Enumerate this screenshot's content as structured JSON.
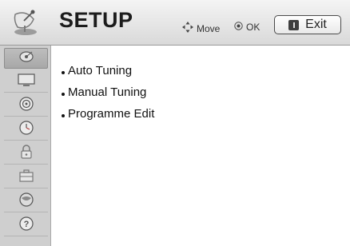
{
  "header": {
    "title": "SETUP",
    "hint_move": "Move",
    "hint_ok": "OK",
    "exit_label": "Exit"
  },
  "sidebar": {
    "items": [
      {
        "icon": "satellite-dish-icon",
        "active": true
      },
      {
        "icon": "display-icon",
        "active": false
      },
      {
        "icon": "audio-icon",
        "active": false
      },
      {
        "icon": "clock-icon",
        "active": false
      },
      {
        "icon": "lock-icon",
        "active": false
      },
      {
        "icon": "toolbox-icon",
        "active": false
      },
      {
        "icon": "network-icon",
        "active": false
      },
      {
        "icon": "help-icon",
        "active": false
      }
    ]
  },
  "menu": {
    "items": [
      {
        "label": "Auto Tuning"
      },
      {
        "label": "Manual Tuning"
      },
      {
        "label": "Programme Edit"
      }
    ]
  },
  "colors": {
    "header_bg": "#e6e6e6",
    "sidebar_bg": "#cfcfcf",
    "active_tab": "#b0b0b0"
  }
}
